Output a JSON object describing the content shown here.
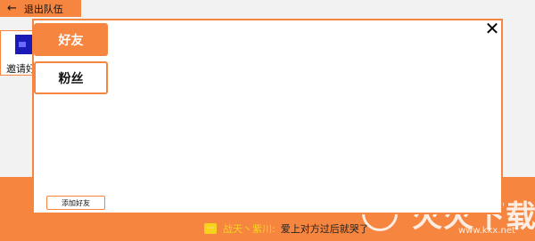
{
  "header": {
    "back_label": "退出队伍"
  },
  "invite_card": {
    "label": "邀请好"
  },
  "modal": {
    "tabs": [
      {
        "label": "好友",
        "active": true
      },
      {
        "label": "粉丝",
        "active": false
      }
    ],
    "add_friend_label": "添加好友",
    "close_icon": "close-icon"
  },
  "ticker": {
    "icon": "chat-bubble-icon",
    "sender": "战天丶紫川:",
    "message": "爱上对方过后就哭了"
  },
  "watermark": {
    "big": "火火下载",
    "small": "www.kkx.net"
  },
  "colors": {
    "accent": "#f5853f",
    "background": "#f2f2f2",
    "panel": "#ffffff",
    "ticker_sender": "#f7d320"
  }
}
